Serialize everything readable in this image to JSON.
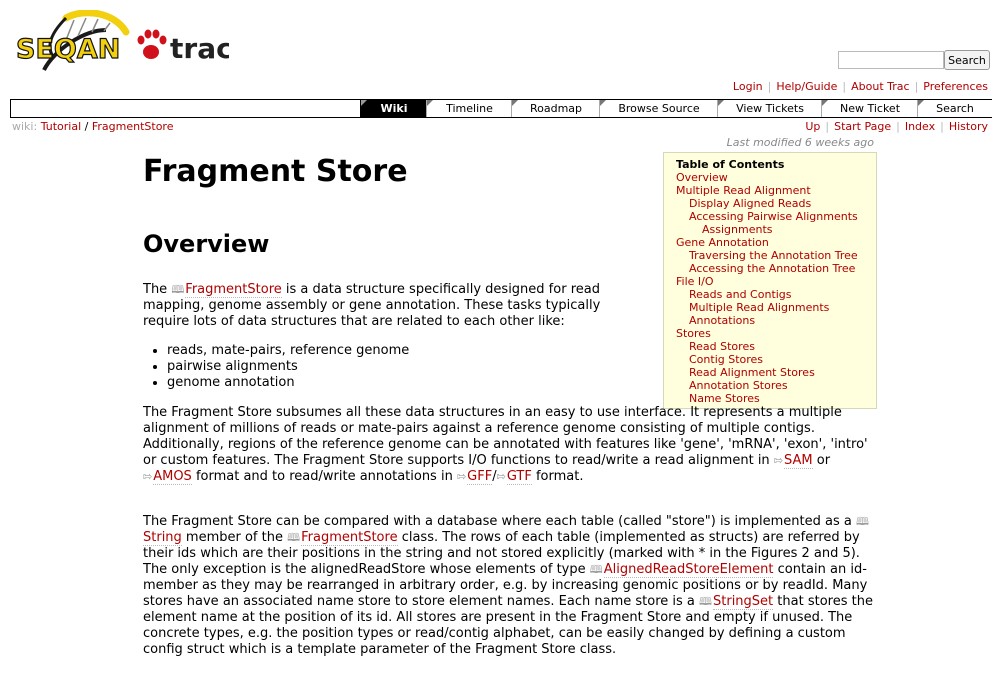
{
  "header": {
    "logo_seqan": "SEQAN",
    "logo_trac": "trac",
    "search_button": "Search",
    "metanav": [
      "Login",
      "Help/Guide",
      "About Trac",
      "Preferences"
    ]
  },
  "mainnav": [
    "Wiki",
    "Timeline",
    "Roadmap",
    "Browse Source",
    "View Tickets",
    "New Ticket",
    "Search"
  ],
  "breadcrumb": {
    "prefix": "wiki:",
    "part1": "Tutorial",
    "separator": "/",
    "part2": "FragmentStore"
  },
  "ctxnav": [
    "Up",
    "Start Page",
    "Index",
    "History"
  ],
  "last_modified": "Last modified 6 weeks ago",
  "toc": {
    "title": "Table of Contents",
    "items": [
      {
        "label": "Overview",
        "level": 1
      },
      {
        "label": "Multiple Read Alignment",
        "level": 1
      },
      {
        "label": "Display Aligned Reads",
        "level": 2
      },
      {
        "label": "Accessing Pairwise Alignments",
        "level": 2
      },
      {
        "label": "Assignments",
        "level": 3
      },
      {
        "label": "Gene Annotation",
        "level": 1
      },
      {
        "label": "Traversing the Annotation Tree",
        "level": 2
      },
      {
        "label": "Accessing the Annotation Tree",
        "level": 2
      },
      {
        "label": "File I/O",
        "level": 1
      },
      {
        "label": "Reads and Contigs",
        "level": 2
      },
      {
        "label": "Multiple Read Alignments",
        "level": 2
      },
      {
        "label": "Annotations",
        "level": 2
      },
      {
        "label": "Stores",
        "level": 1
      },
      {
        "label": "Read Stores",
        "level": 2
      },
      {
        "label": "Contig Stores",
        "level": 2
      },
      {
        "label": "Read Alignment Stores",
        "level": 2
      },
      {
        "label": "Annotation Stores",
        "level": 2
      },
      {
        "label": "Name Stores",
        "level": 2
      }
    ]
  },
  "content": {
    "title": "Fragment Store",
    "section_overview": "Overview",
    "p1": {
      "a": "The ",
      "link": "FragmentStore",
      "b": " is a data structure specifically designed for read mapping, genome assembly or gene annotation. These tasks typically require lots of data structures that are related to each other like:"
    },
    "bullets": [
      "reads, mate-pairs, reference genome",
      "pairwise alignments",
      "genome annotation"
    ],
    "p2": {
      "a": "The Fragment Store subsumes all these data structures in an easy to use interface. It represents a multiple alignment of millions of reads or mate-pairs against a reference genome consisting of multiple contigs. Additionally, regions of the reference genome can be annotated with features like 'gene', 'mRNA', 'exon', 'intro' or custom features. The Fragment Store supports I/O functions to read/write a read alignment in ",
      "sam": "SAM",
      "b": " or ",
      "amos": "AMOS",
      "c": " format and to read/write annotations in ",
      "gff": "GFF",
      "slash": "/",
      "gtf": "GTF",
      "d": " format."
    },
    "p3": {
      "a": "The Fragment Store can be compared with a database where each table (called \"store\") is implemented as a ",
      "string": "String",
      "b": " member of the ",
      "fragmentstore": "FragmentStore",
      "c": " class. The rows of each table (implemented as structs) are referred by their ids which are their positions in the string and not stored explicitly (marked with * in the Figures 2 and 5). The only exception is the alignedReadStore whose elements of type ",
      "element": "AlignedReadStoreElement",
      "d": " contain an id-member as they may be rearranged in arbitrary order, e.g. by increasing genomic positions or by readId. Many stores have an associated name store to store element names. Each name store is a ",
      "stringset": "StringSet",
      "e": " that stores the element name at the position of its id. All stores are present in the Fragment Store and empty if unused. The concrete types, e.g. the position types or read/contig alphabet, can be easily changed by defining a custom config struct which is a template parameter of the Fragment Store class."
    }
  },
  "colors": {
    "link": "#b00000",
    "toc_bg": "#ffffdd",
    "logo_yellow": "#f2d00f"
  }
}
